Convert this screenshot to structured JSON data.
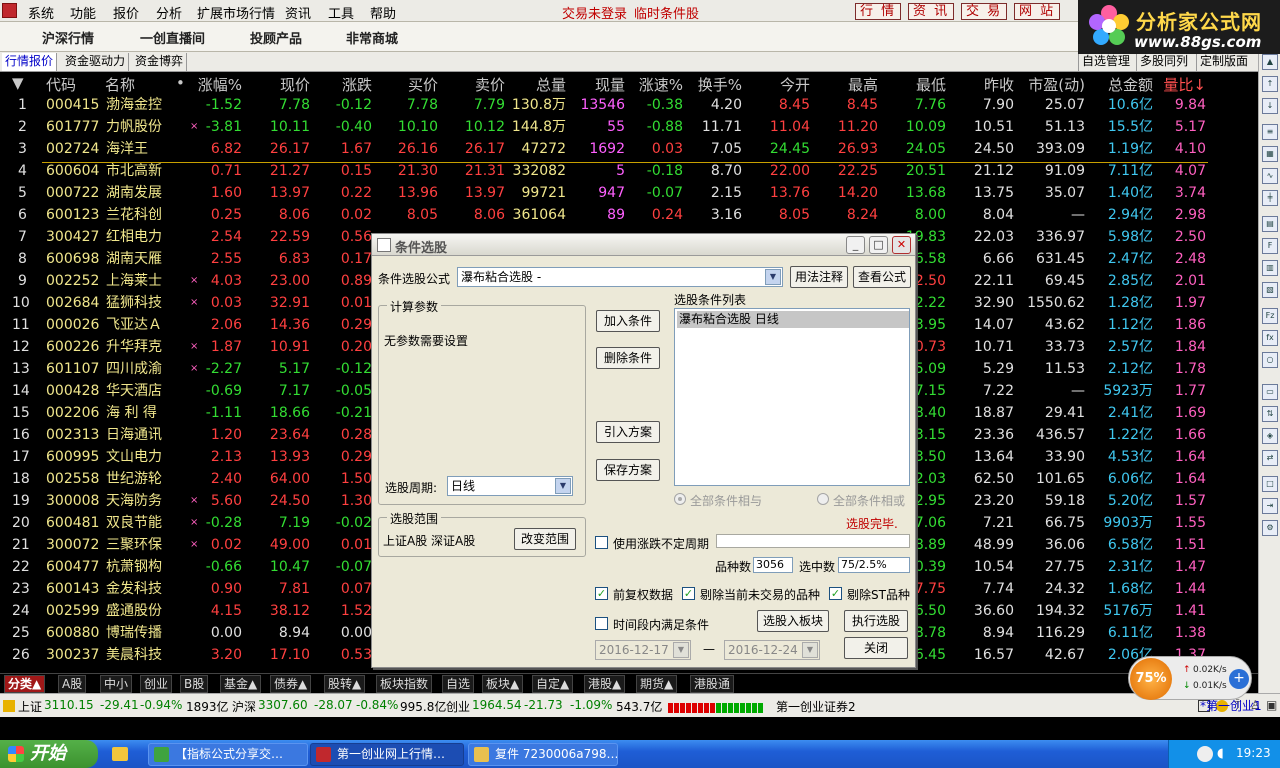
{
  "menubar": {
    "items": [
      "系统",
      "功能",
      "报价",
      "分析",
      "扩展市场行情",
      "资讯",
      "工具",
      "帮助"
    ],
    "status": [
      "交易未登录",
      "临时条件股"
    ],
    "right_buttons": [
      "行 情",
      "资 讯",
      "交 易",
      "网 站"
    ]
  },
  "brand": {
    "name": "分析家公式网",
    "url": "www.88gs.com"
  },
  "navbar": {
    "items": [
      "沪深行情",
      "一创直播间",
      "投顾产品",
      "非常商城"
    ]
  },
  "tabbar": {
    "tabs": [
      "行情报价",
      "资金驱动力",
      "资金博弈"
    ],
    "right": [
      "自选管理",
      "多股同列",
      "定制版面"
    ]
  },
  "table": {
    "headers": [
      "▼",
      "代码",
      "名称",
      "•",
      "涨幅%",
      "现价",
      "涨跌",
      "买价",
      "卖价",
      "总量",
      "现量",
      "涨速%",
      "换手%",
      "今开",
      "最高",
      "最低",
      "昨收",
      "市盈(动)",
      "总金额",
      "量比↓"
    ],
    "rows": [
      [
        "1",
        "000415",
        "渤海金控",
        "",
        "-1.52",
        "7.78",
        "-0.12",
        "7.78",
        "7.79",
        "130.8万",
        "13546",
        "-0.38",
        "4.20",
        "8.45",
        "8.45",
        "7.76",
        "7.90",
        "25.07",
        "10.6亿",
        "9.84"
      ],
      [
        "2",
        "601777",
        "力帆股份",
        "×",
        "-3.81",
        "10.11",
        "-0.40",
        "10.10",
        "10.12",
        "144.8万",
        "55",
        "-0.88",
        "11.71",
        "11.04",
        "11.20",
        "10.09",
        "10.51",
        "51.13",
        "15.5亿",
        "5.17"
      ],
      [
        "3",
        "002724",
        "海洋王",
        "",
        "6.82",
        "26.17",
        "1.67",
        "26.16",
        "26.17",
        "47272",
        "1692",
        "0.03",
        "7.05",
        "24.45",
        "26.93",
        "24.05",
        "24.50",
        "393.09",
        "1.19亿",
        "4.10"
      ],
      [
        "4",
        "600604",
        "市北高新",
        "",
        "0.71",
        "21.27",
        "0.15",
        "21.30",
        "21.31",
        "332082",
        "5",
        "-0.18",
        "8.70",
        "22.00",
        "22.25",
        "20.51",
        "21.12",
        "91.09",
        "7.11亿",
        "4.07"
      ],
      [
        "5",
        "000722",
        "湖南发展",
        "",
        "1.60",
        "13.97",
        "0.22",
        "13.96",
        "13.97",
        "99721",
        "947",
        "-0.07",
        "2.15",
        "13.76",
        "14.20",
        "13.68",
        "13.75",
        "35.07",
        "1.40亿",
        "3.74"
      ],
      [
        "6",
        "600123",
        "兰花科创",
        "",
        "0.25",
        "8.06",
        "0.02",
        "8.05",
        "8.06",
        "361064",
        "89",
        "0.24",
        "3.16",
        "8.05",
        "8.24",
        "8.00",
        "8.04",
        "—",
        "2.94亿",
        "2.98"
      ],
      [
        "7",
        "300427",
        "红相电力",
        "",
        "2.54",
        "22.59",
        "0.56",
        "",
        "",
        "",
        "",
        "",
        "",
        "",
        "",
        "19.83",
        "22.03",
        "336.97",
        "5.98亿",
        "2.50"
      ],
      [
        "8",
        "600698",
        "湖南天雁",
        "",
        "2.55",
        "6.83",
        "0.17",
        "",
        "",
        "",
        "",
        "",
        "",
        "",
        "",
        "6.58",
        "6.66",
        "631.45",
        "2.47亿",
        "2.48"
      ],
      [
        "9",
        "002252",
        "上海莱士",
        "×",
        "4.03",
        "23.00",
        "0.89",
        "",
        "",
        "",
        "",
        "",
        "",
        "",
        "",
        "22.50",
        "22.11",
        "69.45",
        "2.85亿",
        "2.01"
      ],
      [
        "10",
        "002684",
        "猛狮科技",
        "×",
        "0.03",
        "32.91",
        "0.01",
        "",
        "",
        "",
        "",
        "",
        "",
        "",
        "",
        "32.22",
        "32.90",
        "1550.62",
        "1.28亿",
        "1.97"
      ],
      [
        "11",
        "000026",
        "飞亚达Ａ",
        "",
        "2.06",
        "14.36",
        "0.29",
        "",
        "",
        "",
        "",
        "",
        "",
        "",
        "",
        "13.95",
        "14.07",
        "43.62",
        "1.12亿",
        "1.86"
      ],
      [
        "12",
        "600226",
        "升华拜克",
        "×",
        "1.87",
        "10.91",
        "0.20",
        "",
        "",
        "",
        "",
        "",
        "",
        "",
        "",
        "10.73",
        "10.71",
        "33.73",
        "2.57亿",
        "1.84"
      ],
      [
        "13",
        "601107",
        "四川成渝",
        "×",
        "-2.27",
        "5.17",
        "-0.12",
        "",
        "",
        "",
        "",
        "",
        "",
        "",
        "",
        "5.09",
        "5.29",
        "11.53",
        "2.12亿",
        "1.78"
      ],
      [
        "14",
        "000428",
        "华天酒店",
        "",
        "-0.69",
        "7.17",
        "-0.05",
        "",
        "",
        "",
        "",
        "",
        "",
        "",
        "",
        "7.15",
        "7.22",
        "—",
        "5923万",
        "1.77"
      ],
      [
        "15",
        "002206",
        "海 利 得",
        "",
        "-1.11",
        "18.66",
        "-0.21",
        "",
        "",
        "",
        "",
        "",
        "",
        "",
        "",
        "18.40",
        "18.87",
        "29.41",
        "2.41亿",
        "1.69"
      ],
      [
        "16",
        "002313",
        "日海通讯",
        "",
        "1.20",
        "23.64",
        "0.28",
        "",
        "",
        "",
        "",
        "",
        "",
        "",
        "",
        "23.15",
        "23.36",
        "436.57",
        "1.22亿",
        "1.66"
      ],
      [
        "17",
        "600995",
        "文山电力",
        "",
        "2.13",
        "13.93",
        "0.29",
        "",
        "",
        "",
        "",
        "",
        "",
        "",
        "",
        "13.50",
        "13.64",
        "33.90",
        "4.53亿",
        "1.64"
      ],
      [
        "18",
        "002558",
        "世纪游轮",
        "",
        "2.40",
        "64.00",
        "1.50",
        "",
        "",
        "",
        "",
        "",
        "",
        "",
        "",
        "62.03",
        "62.50",
        "101.65",
        "6.06亿",
        "1.64"
      ],
      [
        "19",
        "300008",
        "天海防务",
        "×",
        "5.60",
        "24.50",
        "1.30",
        "",
        "",
        "",
        "",
        "",
        "",
        "",
        "",
        "22.95",
        "23.20",
        "59.18",
        "5.20亿",
        "1.57"
      ],
      [
        "20",
        "600481",
        "双良节能",
        "×",
        "-0.28",
        "7.19",
        "-0.02",
        "",
        "",
        "",
        "",
        "",
        "",
        "",
        "",
        "7.06",
        "7.21",
        "66.75",
        "9903万",
        "1.55"
      ],
      [
        "21",
        "300072",
        "三聚环保",
        "×",
        "0.02",
        "49.00",
        "0.01",
        "",
        "",
        "",
        "",
        "",
        "",
        "",
        "",
        "48.89",
        "48.99",
        "36.06",
        "6.58亿",
        "1.51"
      ],
      [
        "22",
        "600477",
        "杭萧钢构",
        "",
        "-0.66",
        "10.47",
        "-0.07",
        "",
        "",
        "",
        "",
        "",
        "",
        "",
        "",
        "10.39",
        "10.54",
        "27.75",
        "2.31亿",
        "1.47"
      ],
      [
        "23",
        "600143",
        "金发科技",
        "",
        "0.90",
        "7.81",
        "0.07",
        "",
        "",
        "",
        "",
        "",
        "",
        "",
        "",
        "7.75",
        "7.74",
        "24.32",
        "1.68亿",
        "1.44"
      ],
      [
        "24",
        "002599",
        "盛通股份",
        "",
        "4.15",
        "38.12",
        "1.52",
        "",
        "",
        "",
        "",
        "",
        "",
        "",
        "",
        "36.50",
        "36.60",
        "194.32",
        "5176万",
        "1.41"
      ],
      [
        "25",
        "600880",
        "博瑞传播",
        "",
        "0.00",
        "8.94",
        "0.00",
        "",
        "",
        "",
        "",
        "",
        "",
        "",
        "",
        "8.78",
        "8.94",
        "116.29",
        "6.11亿",
        "1.38"
      ],
      [
        "26",
        "300237",
        "美晨科技",
        "",
        "3.20",
        "17.10",
        "0.53",
        "",
        "",
        "",
        "",
        "",
        "",
        "",
        "",
        "16.45",
        "16.57",
        "42.67",
        "2.06亿",
        "1.37"
      ]
    ]
  },
  "cattabs": [
    "分类▲",
    "A股",
    "中小",
    "创业",
    "B股",
    "基金▲",
    "债券▲",
    "股转▲",
    "板块指数",
    "自选",
    "板块▲",
    "自定▲",
    "港股▲",
    "期货▲",
    "港股通"
  ],
  "ticker": {
    "sh_name": "上证",
    "sh_val": "3110.15",
    "sh_chg": "-29.41",
    "sh_pct": "-0.94%",
    "sh_amt": "1893亿",
    "sz_name": "沪深",
    "sz_val": "3307.60",
    "sz_chg": "-28.07",
    "sz_pct": "-0.84%",
    "sz_amt": "995.8亿",
    "cy_name": "创业",
    "cy_val": "1964.54",
    "cy_chg": "-21.73",
    "cy_pct": "-1.09%",
    "cy_amt": "543.7亿",
    "broker": "第一创业证券2",
    "marquee": "*第一创业1"
  },
  "taskbar": {
    "start": "开始",
    "tasks": [
      "【指标公式分享交…",
      "第一创业网上行情…",
      "复件 7230006a798…"
    ],
    "clock": "19:23"
  },
  "net": {
    "percent": "75%",
    "up": "0.02K/s",
    "down": "0.01K/s"
  },
  "dialog": {
    "title": "条件选股",
    "formula_label": "条件选股公式",
    "formula_value": "瀑布粘合选股 -",
    "usage_btn": "用法注释",
    "view_btn": "查看公式",
    "params_legend": "计算参数",
    "params_text": "无参数需要设置",
    "period_label": "选股周期:",
    "period_value": "日线",
    "range_legend": "选股范围",
    "range_text": "上证A股 深证A股",
    "range_btn": "改变范围",
    "add_btn": "加入条件",
    "del_btn": "删除条件",
    "import_btn": "引入方案",
    "save_btn": "保存方案",
    "list_label": "选股条件列表",
    "list_item": "瀑布粘合选股   日线",
    "radio_and": "全部条件相与",
    "radio_or": "全部条件相或",
    "done": "选股完毕.",
    "use_unfixed": "使用涨跌不定周期",
    "count_label": "品种数",
    "count_value": "3056",
    "selected_label": "选中数",
    "selected_value": "75/2.5%",
    "chk_qfq": "前复权数据",
    "chk_exclude": "剔除当前未交易的品种",
    "chk_st": "剔除ST品种",
    "chk_period": "时间段内满足条件",
    "date_from": "2016-12-17",
    "date_sep": "—",
    "date_to": "2016-12-24",
    "to_block_btn": "选股入板块",
    "run_btn": "执行选股",
    "close_btn": "关闭"
  },
  "colors": {
    "up": "#ff4040",
    "down": "#33dd33",
    "code": "#f0e68c",
    "name": "#f0e68c",
    "vol": "#f0e68c",
    "amount": "#40c8f0",
    "neutral": "#e0e0e0"
  }
}
